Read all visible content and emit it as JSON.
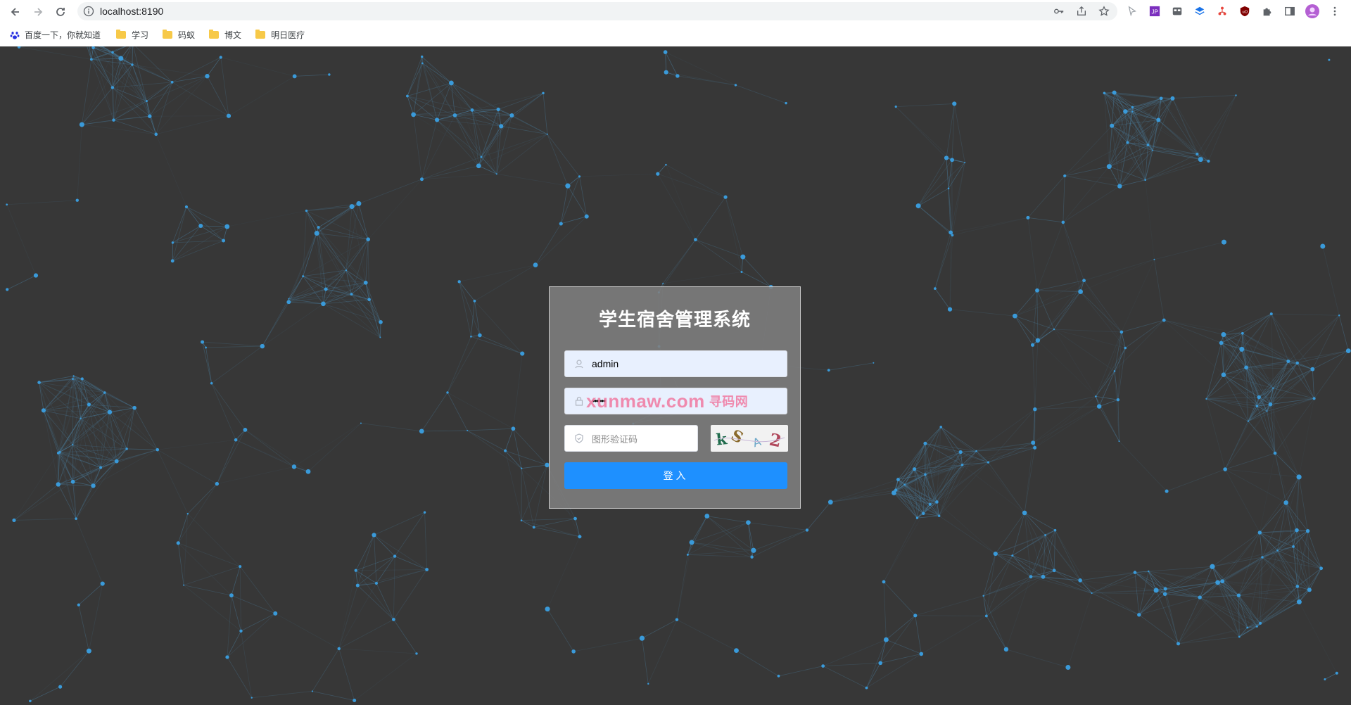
{
  "browser": {
    "url": "localhost:8190",
    "bookmarks": [
      {
        "label": "百度一下，你就知道",
        "icon": "baidu-paw-icon"
      },
      {
        "label": "学习",
        "icon": "folder-icon"
      },
      {
        "label": "码蚁",
        "icon": "folder-icon"
      },
      {
        "label": "博文",
        "icon": "folder-icon"
      },
      {
        "label": "明日医疗",
        "icon": "folder-icon"
      }
    ]
  },
  "login": {
    "title": "学生宿舍管理系统",
    "username_value": "admin",
    "password_mask": "••••••",
    "captcha_placeholder": "图形验证码",
    "captcha_chars": [
      "k",
      "S",
      "A",
      "2"
    ],
    "submit_label": "登入"
  },
  "watermark": {
    "text": "xunmaw.com",
    "suffix": "寻码网"
  },
  "colors": {
    "background": "#373737",
    "node": "#3a9ad9",
    "line": "#4a7c9c",
    "button": "#1e90ff"
  }
}
